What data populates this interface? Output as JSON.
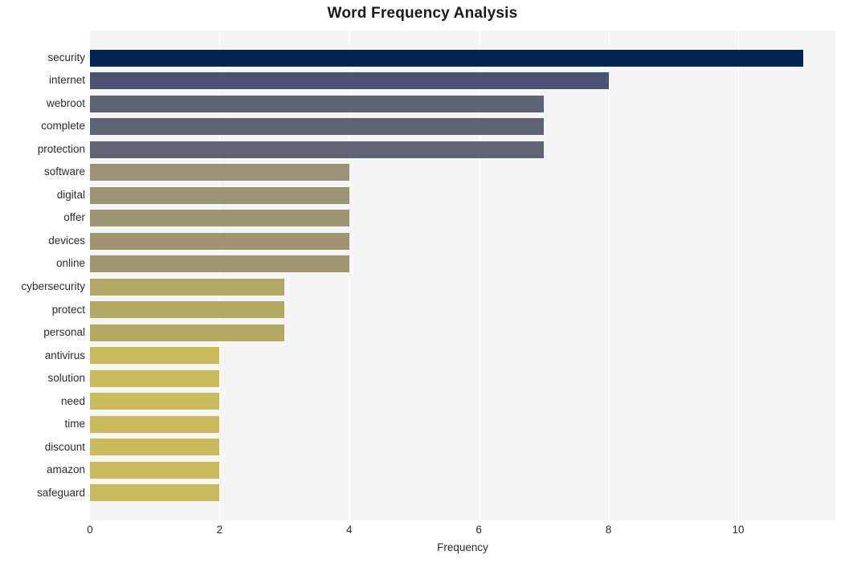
{
  "chart_data": {
    "type": "bar",
    "orientation": "horizontal",
    "title": "Word Frequency Analysis",
    "xlabel": "Frequency",
    "ylabel": "",
    "categories": [
      "security",
      "internet",
      "webroot",
      "complete",
      "protection",
      "software",
      "digital",
      "offer",
      "devices",
      "online",
      "cybersecurity",
      "protect",
      "personal",
      "antivirus",
      "solution",
      "need",
      "time",
      "discount",
      "amazon",
      "safeguard"
    ],
    "values": [
      11,
      8,
      7,
      7,
      7,
      4,
      4,
      4,
      4,
      4,
      3,
      3,
      3,
      2,
      2,
      2,
      2,
      2,
      2,
      2
    ],
    "bar_colors": [
      "#022450",
      "#4a5472",
      "#5e6374",
      "#5f6474",
      "#606576",
      "#9b9474",
      "#9c9573",
      "#9d9672",
      "#9d9671",
      "#9e9770",
      "#b2a765",
      "#b3a864",
      "#b4a963",
      "#cbbb5d",
      "#cbbb5d",
      "#cbbb5d",
      "#cbbb5d",
      "#cbbb5d",
      "#cbbb5d",
      "#cbbb5d"
    ],
    "xticks": [
      0,
      2,
      4,
      6,
      8,
      10
    ],
    "xtick_labels": [
      "0",
      "2",
      "4",
      "6",
      "8",
      "10"
    ],
    "xlim": [
      0,
      11.5
    ],
    "grid": "vertical-only",
    "legend": "none",
    "plot_background": "#f5f5f6",
    "figure_background": "#ffffff",
    "gridline_color": "#ffffff",
    "title_color": "#1a1a1a",
    "tick_label_color": "#2b2b2b"
  }
}
